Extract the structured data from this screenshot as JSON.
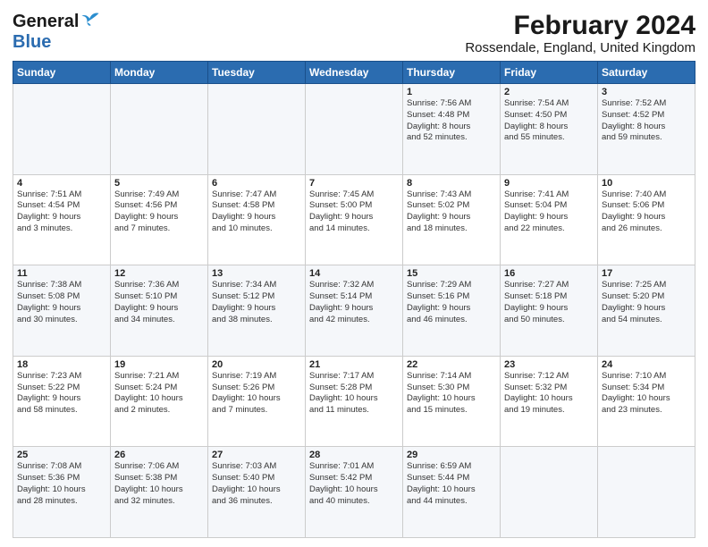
{
  "header": {
    "logo_general": "General",
    "logo_blue": "Blue",
    "title": "February 2024",
    "subtitle": "Rossendale, England, United Kingdom"
  },
  "days_of_week": [
    "Sunday",
    "Monday",
    "Tuesday",
    "Wednesday",
    "Thursday",
    "Friday",
    "Saturday"
  ],
  "weeks": [
    [
      {
        "day": "",
        "info": ""
      },
      {
        "day": "",
        "info": ""
      },
      {
        "day": "",
        "info": ""
      },
      {
        "day": "",
        "info": ""
      },
      {
        "day": "1",
        "info": "Sunrise: 7:56 AM\nSunset: 4:48 PM\nDaylight: 8 hours\nand 52 minutes."
      },
      {
        "day": "2",
        "info": "Sunrise: 7:54 AM\nSunset: 4:50 PM\nDaylight: 8 hours\nand 55 minutes."
      },
      {
        "day": "3",
        "info": "Sunrise: 7:52 AM\nSunset: 4:52 PM\nDaylight: 8 hours\nand 59 minutes."
      }
    ],
    [
      {
        "day": "4",
        "info": "Sunrise: 7:51 AM\nSunset: 4:54 PM\nDaylight: 9 hours\nand 3 minutes."
      },
      {
        "day": "5",
        "info": "Sunrise: 7:49 AM\nSunset: 4:56 PM\nDaylight: 9 hours\nand 7 minutes."
      },
      {
        "day": "6",
        "info": "Sunrise: 7:47 AM\nSunset: 4:58 PM\nDaylight: 9 hours\nand 10 minutes."
      },
      {
        "day": "7",
        "info": "Sunrise: 7:45 AM\nSunset: 5:00 PM\nDaylight: 9 hours\nand 14 minutes."
      },
      {
        "day": "8",
        "info": "Sunrise: 7:43 AM\nSunset: 5:02 PM\nDaylight: 9 hours\nand 18 minutes."
      },
      {
        "day": "9",
        "info": "Sunrise: 7:41 AM\nSunset: 5:04 PM\nDaylight: 9 hours\nand 22 minutes."
      },
      {
        "day": "10",
        "info": "Sunrise: 7:40 AM\nSunset: 5:06 PM\nDaylight: 9 hours\nand 26 minutes."
      }
    ],
    [
      {
        "day": "11",
        "info": "Sunrise: 7:38 AM\nSunset: 5:08 PM\nDaylight: 9 hours\nand 30 minutes."
      },
      {
        "day": "12",
        "info": "Sunrise: 7:36 AM\nSunset: 5:10 PM\nDaylight: 9 hours\nand 34 minutes."
      },
      {
        "day": "13",
        "info": "Sunrise: 7:34 AM\nSunset: 5:12 PM\nDaylight: 9 hours\nand 38 minutes."
      },
      {
        "day": "14",
        "info": "Sunrise: 7:32 AM\nSunset: 5:14 PM\nDaylight: 9 hours\nand 42 minutes."
      },
      {
        "day": "15",
        "info": "Sunrise: 7:29 AM\nSunset: 5:16 PM\nDaylight: 9 hours\nand 46 minutes."
      },
      {
        "day": "16",
        "info": "Sunrise: 7:27 AM\nSunset: 5:18 PM\nDaylight: 9 hours\nand 50 minutes."
      },
      {
        "day": "17",
        "info": "Sunrise: 7:25 AM\nSunset: 5:20 PM\nDaylight: 9 hours\nand 54 minutes."
      }
    ],
    [
      {
        "day": "18",
        "info": "Sunrise: 7:23 AM\nSunset: 5:22 PM\nDaylight: 9 hours\nand 58 minutes."
      },
      {
        "day": "19",
        "info": "Sunrise: 7:21 AM\nSunset: 5:24 PM\nDaylight: 10 hours\nand 2 minutes."
      },
      {
        "day": "20",
        "info": "Sunrise: 7:19 AM\nSunset: 5:26 PM\nDaylight: 10 hours\nand 7 minutes."
      },
      {
        "day": "21",
        "info": "Sunrise: 7:17 AM\nSunset: 5:28 PM\nDaylight: 10 hours\nand 11 minutes."
      },
      {
        "day": "22",
        "info": "Sunrise: 7:14 AM\nSunset: 5:30 PM\nDaylight: 10 hours\nand 15 minutes."
      },
      {
        "day": "23",
        "info": "Sunrise: 7:12 AM\nSunset: 5:32 PM\nDaylight: 10 hours\nand 19 minutes."
      },
      {
        "day": "24",
        "info": "Sunrise: 7:10 AM\nSunset: 5:34 PM\nDaylight: 10 hours\nand 23 minutes."
      }
    ],
    [
      {
        "day": "25",
        "info": "Sunrise: 7:08 AM\nSunset: 5:36 PM\nDaylight: 10 hours\nand 28 minutes."
      },
      {
        "day": "26",
        "info": "Sunrise: 7:06 AM\nSunset: 5:38 PM\nDaylight: 10 hours\nand 32 minutes."
      },
      {
        "day": "27",
        "info": "Sunrise: 7:03 AM\nSunset: 5:40 PM\nDaylight: 10 hours\nand 36 minutes."
      },
      {
        "day": "28",
        "info": "Sunrise: 7:01 AM\nSunset: 5:42 PM\nDaylight: 10 hours\nand 40 minutes."
      },
      {
        "day": "29",
        "info": "Sunrise: 6:59 AM\nSunset: 5:44 PM\nDaylight: 10 hours\nand 44 minutes."
      },
      {
        "day": "",
        "info": ""
      },
      {
        "day": "",
        "info": ""
      }
    ]
  ]
}
